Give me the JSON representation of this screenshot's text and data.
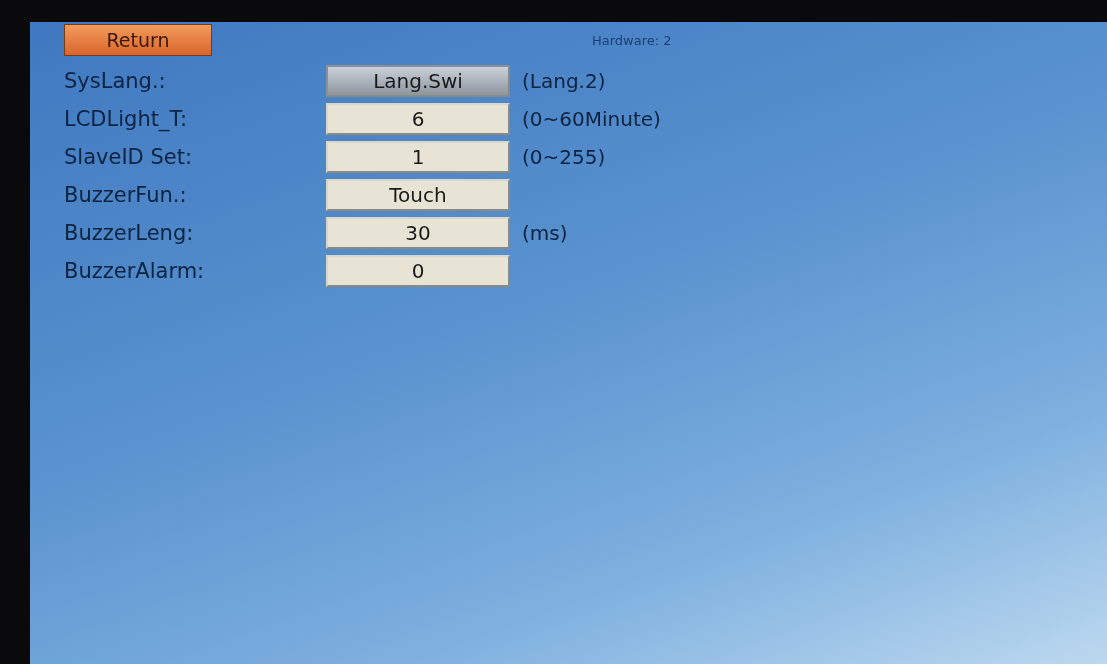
{
  "header": {
    "return_button": "Return",
    "hardware_label": "Hardware: 2"
  },
  "settings": [
    {
      "label": "SysLang.:",
      "value": "Lang.Swi",
      "kind": "button",
      "unit": "(Lang.2)"
    },
    {
      "label": "LCDLight_T:",
      "value": "6",
      "kind": "field",
      "unit": "(0~60Minute)"
    },
    {
      "label": "SlaveID Set:",
      "value": "1",
      "kind": "field",
      "unit": "(0~255)"
    },
    {
      "label": "BuzzerFun.:",
      "value": "Touch",
      "kind": "field"
    },
    {
      "label": "BuzzerLeng:",
      "value": "30",
      "kind": "field",
      "unit": "(ms)"
    },
    {
      "label": "BuzzerAlarm:",
      "value": "0",
      "kind": "field"
    }
  ]
}
